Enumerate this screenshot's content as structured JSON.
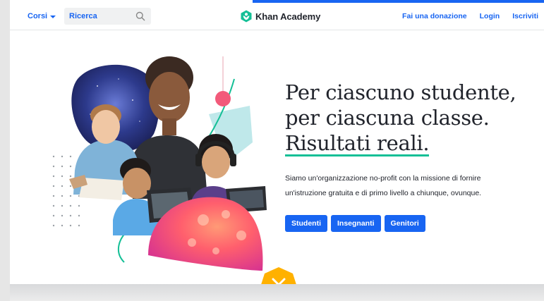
{
  "nav": {
    "courses_label": "Corsi",
    "search_placeholder": "Ricerca",
    "logo_text": "Khan Academy",
    "links": [
      "Fai una donazione",
      "Login",
      "Iscriviti"
    ]
  },
  "hero": {
    "headline_line1": "Per ciascuno studente,",
    "headline_line2": "per ciascuna classe.",
    "headline_line3": "Risultati reali.",
    "description": "Siamo un'organizzazione no-profit con la missione di fornire un'istruzione gratuita e di primo livello a chiunque, ovunque.",
    "buttons": [
      "Studenti",
      "Insegnanti",
      "Genitori"
    ]
  },
  "colors": {
    "brand_blue": "#1865f2",
    "logo_green": "#14bf96",
    "scroll_yellow": "#ffb100",
    "text_dark": "#21242c"
  },
  "icons": {
    "search": "search-icon",
    "logo": "khan-academy-logo-icon",
    "courses_caret": "caret-down-icon",
    "scroll": "chevron-down-icon"
  }
}
